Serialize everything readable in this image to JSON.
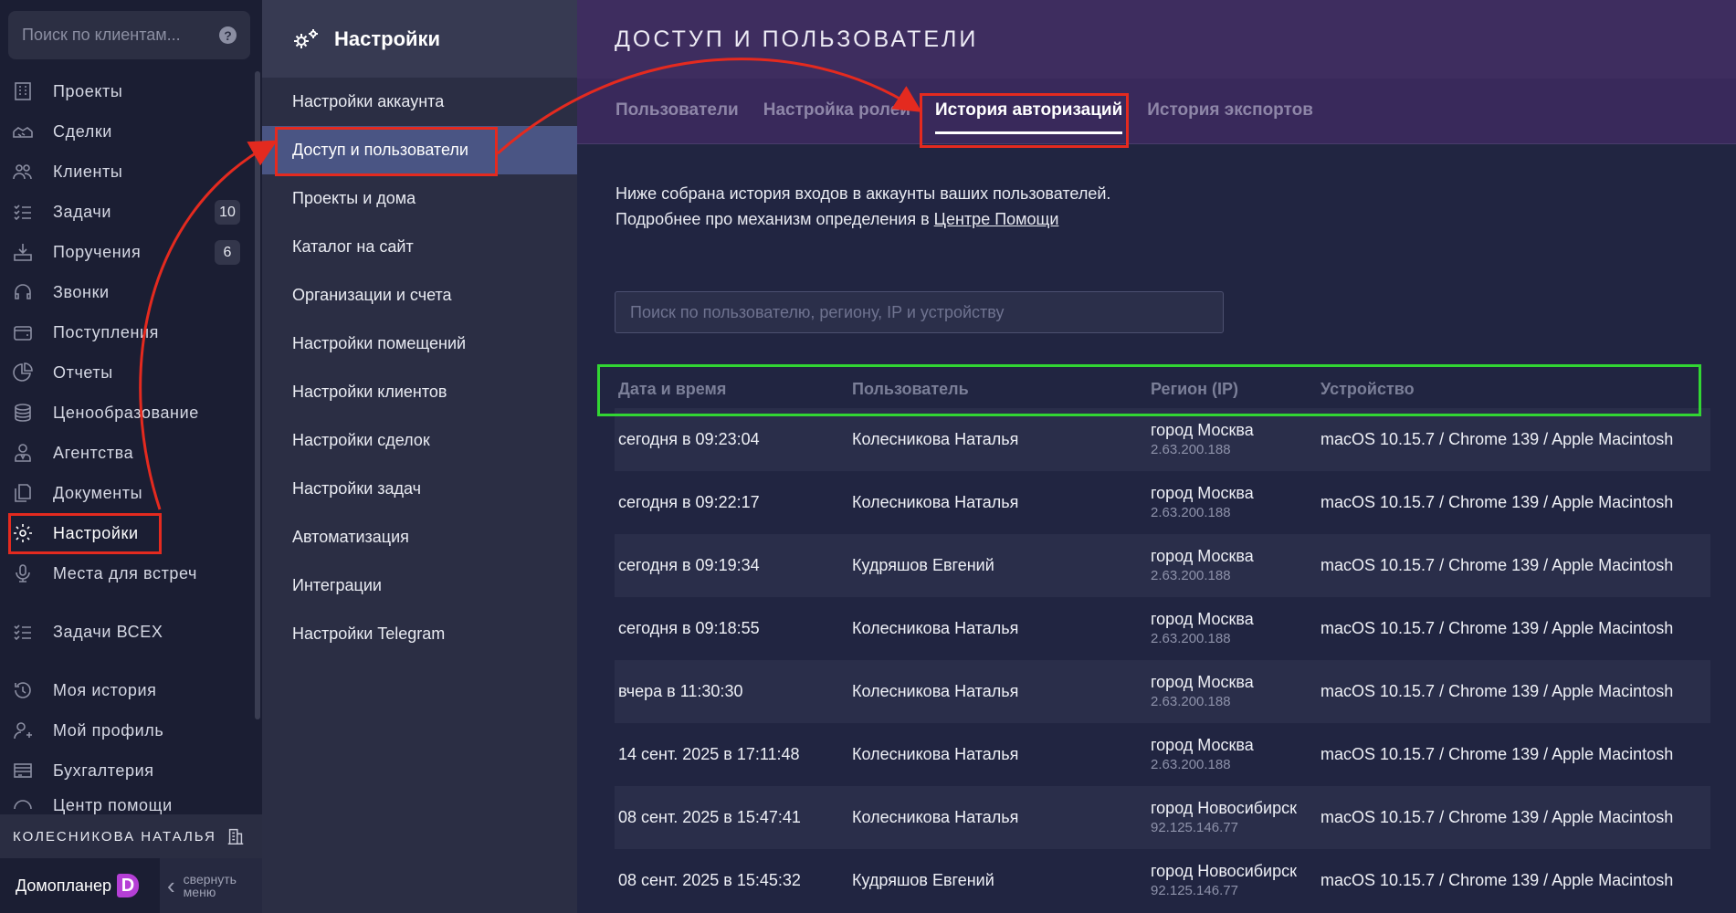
{
  "nav": {
    "search_placeholder": "Поиск по клиентам...",
    "items": [
      {
        "label": "Проекты",
        "icon": "building-icon"
      },
      {
        "label": "Сделки",
        "icon": "handshake-icon"
      },
      {
        "label": "Клиенты",
        "icon": "users-icon"
      },
      {
        "label": "Задачи",
        "icon": "tasks-icon",
        "badge": "10"
      },
      {
        "label": "Поручения",
        "icon": "assignment-icon",
        "badge": "6"
      },
      {
        "label": "Звонки",
        "icon": "headset-icon"
      },
      {
        "label": "Поступления",
        "icon": "wallet-icon"
      },
      {
        "label": "Отчеты",
        "icon": "pie-chart-icon"
      },
      {
        "label": "Ценообразование",
        "icon": "coins-icon"
      },
      {
        "label": "Агентства",
        "icon": "agent-icon"
      },
      {
        "label": "Документы",
        "icon": "documents-icon"
      },
      {
        "label": "Настройки",
        "icon": "gear-icon"
      },
      {
        "label": "Места для встреч",
        "icon": "microphone-icon"
      },
      {
        "label": "Задачи ВСЕХ",
        "icon": "tasks-all-icon"
      },
      {
        "label": "Моя история",
        "icon": "history-icon"
      },
      {
        "label": "Мой профиль",
        "icon": "profile-icon"
      },
      {
        "label": "Бухгалтерия",
        "icon": "accounting-icon"
      },
      {
        "label": "Центр помощи",
        "icon": "help-center-icon"
      }
    ],
    "user_name": "КОЛЕСНИКОВА НАТАЛЬЯ",
    "brand": "Домопланер",
    "brand_logo": "D",
    "collapse_line1": "свернуть",
    "collapse_line2": "меню"
  },
  "settings_menu": {
    "title": "Настройки",
    "items": [
      "Настройки аккаунта",
      "Доступ и пользователи",
      "Проекты и дома",
      "Каталог на сайт",
      "Организации и счета",
      "Настройки помещений",
      "Настройки клиентов",
      "Настройки сделок",
      "Настройки задач",
      "Автоматизация",
      "Интеграции",
      "Настройки Telegram"
    ]
  },
  "main": {
    "title": "ДОСТУП И ПОЛЬЗОВАТЕЛИ",
    "tabs": [
      "Пользователи",
      "Настройка ролей",
      "История авторизаций",
      "История экспортов"
    ],
    "intro_line1": "Ниже собрана история входов в аккаунты ваших пользователей.",
    "intro_line2_prefix": "Подробнее про механизм определения в ",
    "intro_link": "Центре Помощи",
    "filter_placeholder": "Поиск по пользователю, региону, IP и устройству",
    "columns": [
      "Дата и время",
      "Пользователь",
      "Регион (IP)",
      "Устройство"
    ],
    "rows": [
      {
        "datetime": "сегодня в 09:23:04",
        "user": "Колесникова Наталья",
        "region": "город Москва",
        "ip": "2.63.200.188",
        "device": "macOS 10.15.7 / Chrome 139 / Apple Macintosh"
      },
      {
        "datetime": "сегодня в 09:22:17",
        "user": "Колесникова Наталья",
        "region": "город Москва",
        "ip": "2.63.200.188",
        "device": "macOS 10.15.7 / Chrome 139 / Apple Macintosh"
      },
      {
        "datetime": "сегодня в 09:19:34",
        "user": "Кудряшов Евгений",
        "region": "город Москва",
        "ip": "2.63.200.188",
        "device": "macOS 10.15.7 / Chrome 139 / Apple Macintosh"
      },
      {
        "datetime": "сегодня в 09:18:55",
        "user": "Колесникова Наталья",
        "region": "город Москва",
        "ip": "2.63.200.188",
        "device": "macOS 10.15.7 / Chrome 139 / Apple Macintosh"
      },
      {
        "datetime": "вчера в 11:30:30",
        "user": "Колесникова Наталья",
        "region": "город Москва",
        "ip": "2.63.200.188",
        "device": "macOS 10.15.7 / Chrome 139 / Apple Macintosh"
      },
      {
        "datetime": "14 сент. 2025 в 17:11:48",
        "user": "Колесникова Наталья",
        "region": "город Москва",
        "ip": "2.63.200.188",
        "device": "macOS 10.15.7 / Chrome 139 / Apple Macintosh"
      },
      {
        "datetime": "08 сент. 2025 в 15:47:41",
        "user": "Колесникова Наталья",
        "region": "город Новосибирск",
        "ip": "92.125.146.77",
        "device": "macOS 10.15.7 / Chrome 139 / Apple Macintosh"
      },
      {
        "datetime": "08 сент. 2025 в 15:45:32",
        "user": "Кудряшов Евгений",
        "region": "город Новосибирск",
        "ip": "92.125.146.77",
        "device": "macOS 10.15.7 / Chrome 139 / Apple Macintosh"
      }
    ]
  },
  "colors": {
    "annotation_red": "#e42a1f",
    "annotation_green": "#32d633",
    "brand_accent": "#b53fd6",
    "active_menu": "#4a5584"
  }
}
